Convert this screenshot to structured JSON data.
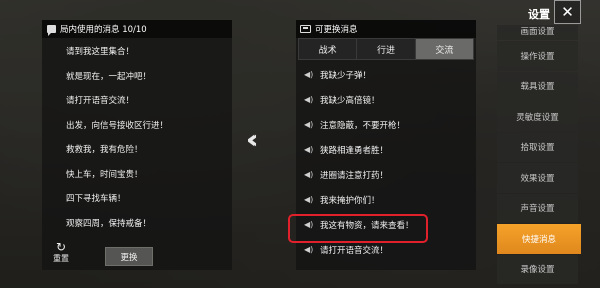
{
  "left_panel": {
    "title": "局内使用的消息 10/10",
    "messages": [
      "请到我这里集合！",
      "就是现在，一起冲吧！",
      "请打开语音交流！",
      "出发，向信号接收区行进！",
      "救救我，我有危险！",
      "快上车，时间宝贵！",
      "四下寻找车辆！",
      "观察四周，保持戒备！"
    ],
    "reset_label": "重置",
    "change_label": "更换"
  },
  "swap_arrow": "«",
  "right_panel": {
    "title": "可更换消息",
    "tabs": [
      "战术",
      "行进",
      "交流"
    ],
    "active_tab": "交流",
    "options": [
      "我缺少子弹！",
      "我缺少高倍镜！",
      "注意隐蔽，不要开枪！",
      "狭路相逢勇者胜！",
      "进圈请注意打药！",
      "我来掩护你们！",
      "我这有物资，请来查看！",
      "请打开语音交流！"
    ],
    "highlighted_option": "我这有物资，请来查看！"
  },
  "sidebar": {
    "title": "设置",
    "close_label": "✕",
    "items": [
      "画面设置",
      "操作设置",
      "载具设置",
      "灵敏度设置",
      "拾取设置",
      "效果设置",
      "声音设置",
      "快捷消息",
      "录像设置"
    ],
    "active": "快捷消息"
  },
  "colors": {
    "accent": "#f0961f",
    "highlight": "#e0202a"
  },
  "icons": {
    "chat": "chat-icon",
    "switch": "switch-icon",
    "speaker": "speaker-icon",
    "refresh": "refresh-icon",
    "close": "close-icon"
  }
}
